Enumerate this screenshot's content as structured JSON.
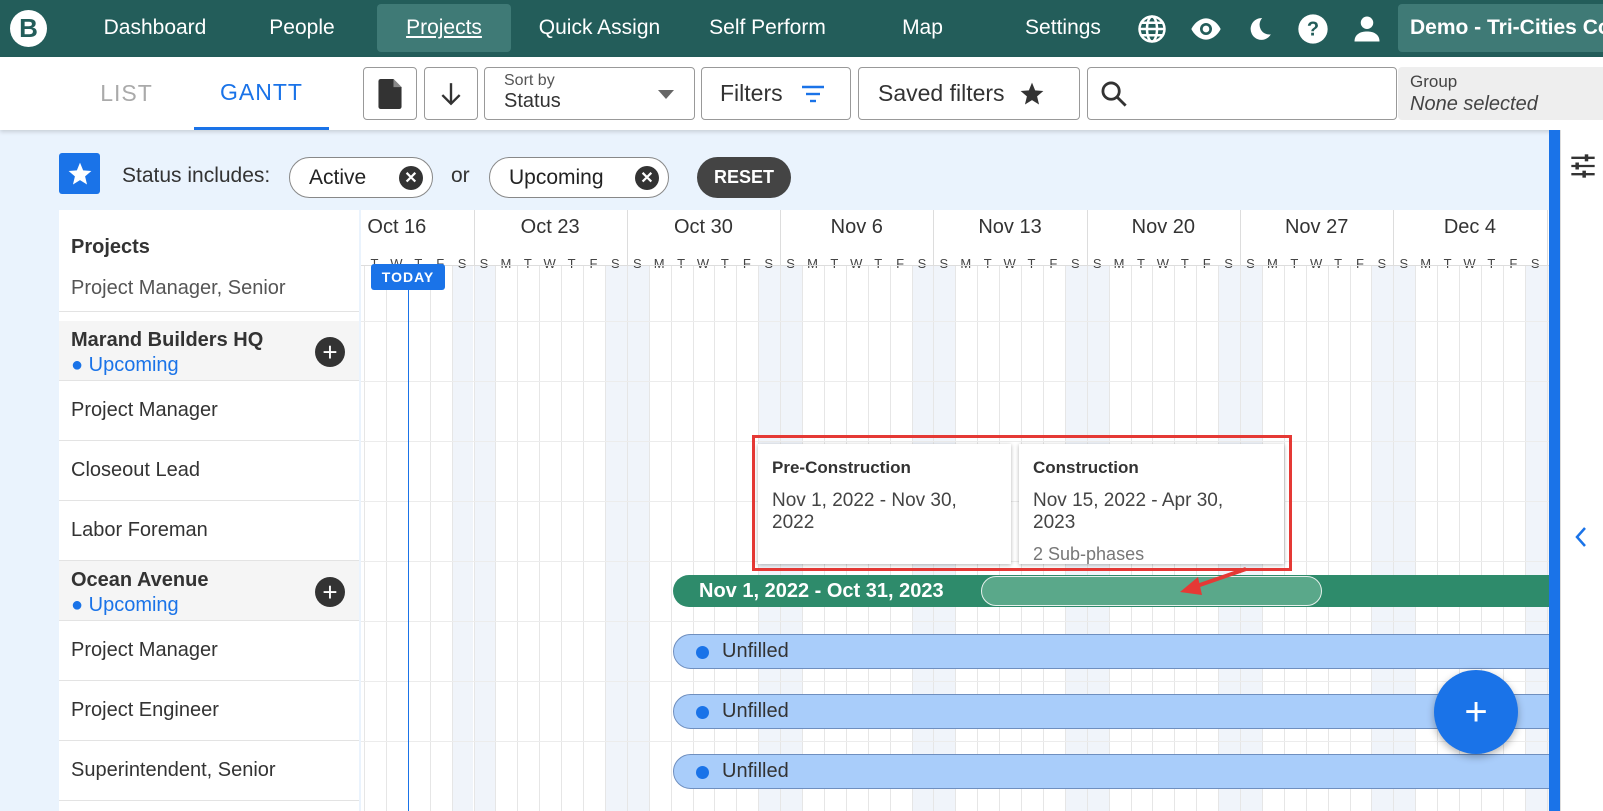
{
  "nav": {
    "logo": "B",
    "items": [
      "Dashboard",
      "People",
      "Projects",
      "Quick Assign",
      "Self Perform",
      "Map",
      "Settings"
    ],
    "active": "Projects",
    "org": "Demo - Tri-Cities Co"
  },
  "toolbar": {
    "tab_list": "LIST",
    "tab_gantt": "GANTT",
    "sort_label": "Sort by",
    "sort_value": "Status",
    "filters_label": "Filters",
    "saved_filters_label": "Saved filters",
    "search_placeholder": "",
    "group_label": "Group",
    "group_value": "None selected"
  },
  "filterbar": {
    "status_label": "Status includes:",
    "chip1": "Active",
    "or_label": "or",
    "chip2": "Upcoming",
    "reset_label": "RESET"
  },
  "left": {
    "header": "Projects",
    "partial_row": "Project Manager, Senior",
    "project1": {
      "name": "Marand Builders HQ",
      "status": "● Upcoming"
    },
    "p1_roles": [
      "Project Manager",
      "Closeout Lead",
      "Labor Foreman"
    ],
    "project2": {
      "name": "Ocean Avenue",
      "status": "● Upcoming"
    },
    "p2_roles": [
      "Project Manager",
      "Project Engineer",
      "Superintendent, Senior"
    ]
  },
  "gantt": {
    "weeks": [
      "Oct 16",
      "Oct 23",
      "Oct 30",
      "Nov 6",
      "Nov 13",
      "Nov 20",
      "Nov 27",
      "Dec 4"
    ],
    "days": [
      "S",
      "M",
      "T",
      "W",
      "T",
      "F",
      "S"
    ],
    "today_label": "TODAY",
    "project_bar_label": "Nov 1, 2022 - Oct 31, 2023",
    "unfilled_label": "Unfilled"
  },
  "popover": {
    "phase1": {
      "title": "Pre-Construction",
      "dates": "Nov 1, 2022 - Nov 30, 2022"
    },
    "phase2": {
      "title": "Construction",
      "dates": "Nov 15, 2022 - Apr 30, 2023",
      "sub": "2 Sub-phases"
    }
  },
  "colors": {
    "nav": "#235d5a",
    "accent": "#1a73e8",
    "project_bar": "#2e8b6b",
    "role_bar": "#a9cdfa",
    "highlight": "#e53935"
  }
}
